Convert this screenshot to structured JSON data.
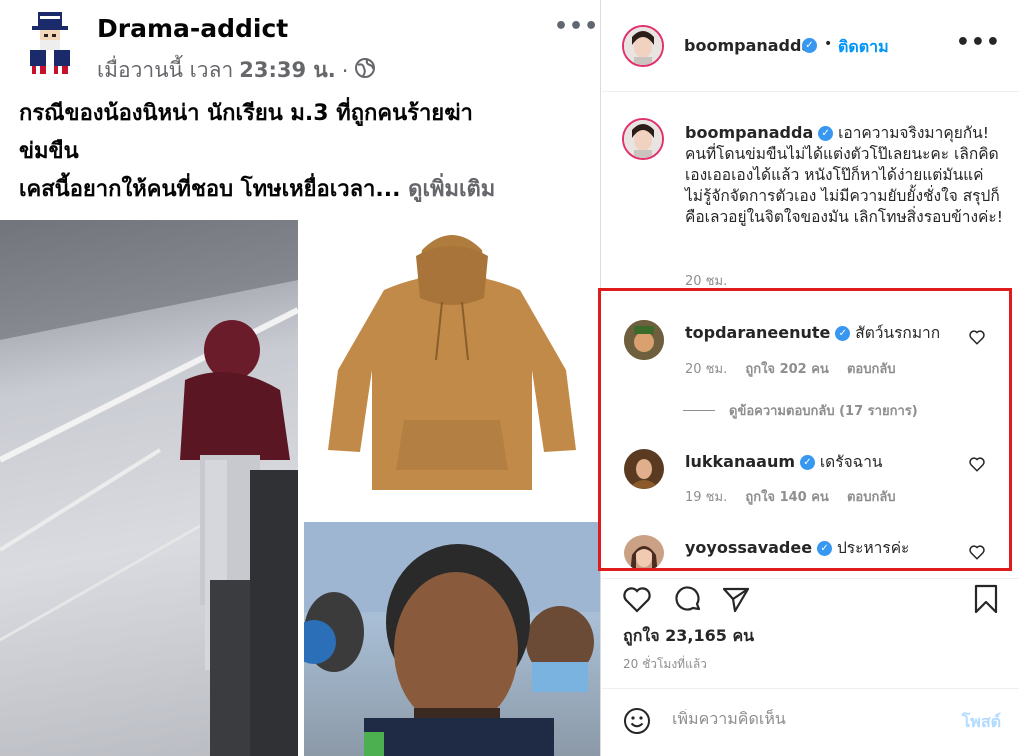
{
  "fb_post": {
    "page_name": "Drama-addict",
    "date_prefix": "เมื่อวานนี้ เวลา",
    "time": "23:39 น.",
    "dot": "·",
    "text_line1": "กรณีของน้องนิหน่า นักเรียน ม.3 ที่ถูกคนร้ายฆ่า",
    "text_line2": "ข่มขืน",
    "text_line3": "เคสนี้อยากให้คนที่ชอบ โทษเหยื่อเวลา...",
    "see_more": "ดูเพิ่มเติม",
    "more_label": "•••"
  },
  "ig": {
    "owner": "boompanadda",
    "separator": "•",
    "follow_label": "ติดตาม",
    "more_label": "•••",
    "caption_text": "เอาความจริงมาคุยกัน! คนที่โดนข่มขืนไม่ได้แต่งตัวโป๊เลยนะคะ เลิกคิดเองเออเองได้แล้ว หนังโป๊ก็หาได้ง่ายแต่มันแค่ไม่รู้จักจัดการตัวเอง ไม่มีความยับยั้งชั่งใจ สรุปก็คือเลวอยู่ในจิตใจของมัน เลิกโทษสิ่งรอบข้างค่ะ!",
    "caption_time": "20 ชม.",
    "comments": [
      {
        "user": "topdaraneenute",
        "text": "สัตว์นรกมาก",
        "time": "20 ชม.",
        "likes": "ถูกใจ 202 คน",
        "reply": "ตอบกลับ"
      },
      {
        "user": "lukkanaaum",
        "text": "เดรัจฉาน",
        "time": "19 ชม.",
        "likes": "ถูกใจ 140 คน",
        "reply": "ตอบกลับ"
      },
      {
        "user": "yoyossavadee",
        "text": "ประหารค่ะ"
      }
    ],
    "view_replies": "ดูข้อความตอบกลับ (17 รายการ)",
    "like_count": "ถูกใจ 23,165 คน",
    "post_time": "20 ชั่วโมงที่แล้ว",
    "comment_placeholder": "เพิ่มความคิดเห็น",
    "post_label": "โพสต์",
    "accent": "#0095f6",
    "highlight_color": "#e01b1b"
  }
}
